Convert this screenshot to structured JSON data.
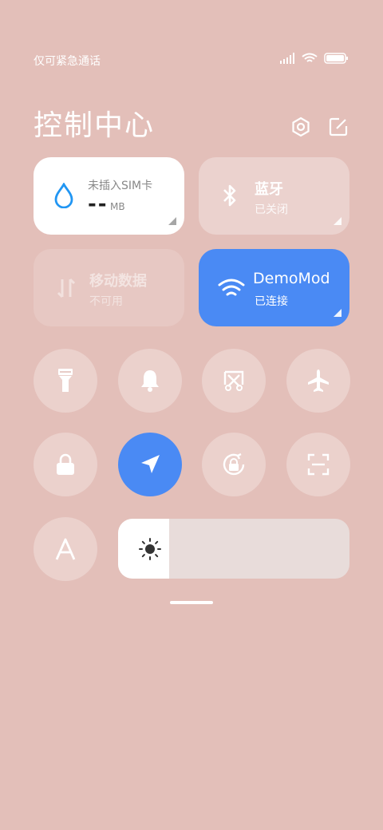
{
  "status": {
    "carrier_text": "仅可紧急通话"
  },
  "header": {
    "title": "控制中心"
  },
  "tiles": {
    "data": {
      "label": "未插入SIM卡",
      "value": "--",
      "unit": "MB"
    },
    "bluetooth": {
      "label": "蓝牙",
      "state": "已关闭"
    },
    "mobile_data": {
      "label": "移动数据",
      "state": "不可用"
    },
    "wifi": {
      "label": "DemoMod",
      "state": "已连接"
    }
  },
  "toggles": [
    "flashlight-icon",
    "bell-icon",
    "screenshot-icon",
    "airplane-icon",
    "lock-icon",
    "location-icon",
    "rotation-lock-icon",
    "scan-icon",
    "font-icon"
  ],
  "brightness": {
    "level": 0.2
  },
  "colors": {
    "background": "#e3bfb9",
    "accent": "#4a8af4",
    "data_icon": "#2196f3"
  }
}
